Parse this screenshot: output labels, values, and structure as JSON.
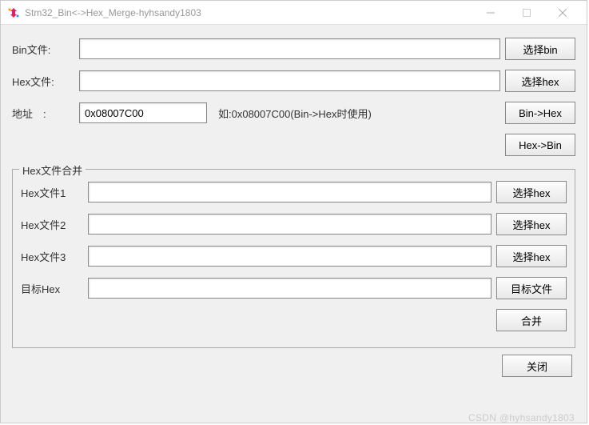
{
  "window": {
    "title": "Stm32_Bin<->Hex_Merge-hyhsandy1803"
  },
  "top": {
    "bin_label": "Bin文件:",
    "bin_value": "",
    "select_bin_btn": "选择bin",
    "hex_label": "Hex文件:",
    "hex_value": "",
    "select_hex_btn": "选择hex",
    "addr_label": "地址　:",
    "addr_value": "0x08007C00",
    "addr_hint": "如:0x08007C00(Bin->Hex时使用)",
    "bin_to_hex_btn": "Bin->Hex",
    "hex_to_bin_btn": "Hex->Bin"
  },
  "merge": {
    "group_title": "Hex文件合并",
    "hex1_label": "Hex文件1",
    "hex1_value": "",
    "hex1_btn": "选择hex",
    "hex2_label": "Hex文件2",
    "hex2_value": "",
    "hex2_btn": "选择hex",
    "hex3_label": "Hex文件3",
    "hex3_value": "",
    "hex3_btn": "选择hex",
    "target_label": "目标Hex",
    "target_value": "",
    "target_btn": "目标文件",
    "merge_btn": "合并"
  },
  "footer": {
    "close_btn": "关闭",
    "watermark": "CSDN @hyhsandy1803"
  }
}
